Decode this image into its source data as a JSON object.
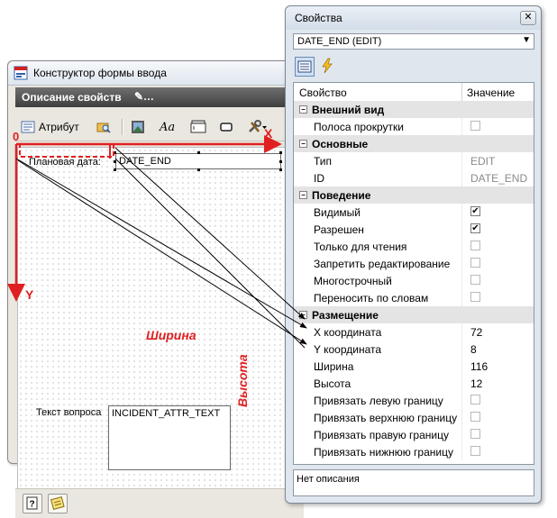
{
  "designer": {
    "title": "Конструктор формы ввода",
    "description_bar": "Описание свойств",
    "toolbar": {
      "attribute_label": "Атрибут"
    },
    "fields": [
      {
        "label": "Плановая дата:",
        "value": "DATE_END"
      },
      {
        "label": "Текст вопроса",
        "value": "INCIDENT_ATTR_TEXT"
      }
    ]
  },
  "annotations": {
    "origin": "0",
    "x_axis": "X",
    "y_axis": "Y",
    "width": "Ширина",
    "height": "Высота"
  },
  "properties": {
    "title": "Свойства",
    "close": "✕",
    "selected_object": "DATE_END (EDIT)",
    "columns": {
      "property": "Свойство",
      "value": "Значение"
    },
    "categories": [
      {
        "name": "Внешний вид",
        "rows": [
          {
            "name": "Полоса прокрутки",
            "type": "check",
            "checked": false
          }
        ]
      },
      {
        "name": "Основные",
        "rows": [
          {
            "name": "Тип",
            "type": "text",
            "value": "EDIT",
            "muted": true
          },
          {
            "name": "ID",
            "type": "text",
            "value": "DATE_END",
            "muted": true
          }
        ]
      },
      {
        "name": "Поведение",
        "rows": [
          {
            "name": "Видимый",
            "type": "check",
            "checked": true
          },
          {
            "name": "Разрешен",
            "type": "check",
            "checked": true
          },
          {
            "name": "Только для чтения",
            "type": "check",
            "checked": false
          },
          {
            "name": "Запретить редактирование",
            "type": "check",
            "checked": false
          },
          {
            "name": "Многострочный",
            "type": "check",
            "checked": false
          },
          {
            "name": "Переносить по словам",
            "type": "check",
            "checked": false
          }
        ]
      },
      {
        "name": "Размещение",
        "rows": [
          {
            "name": "X координата",
            "type": "text",
            "value": "72"
          },
          {
            "name": "Y координата",
            "type": "text",
            "value": "8"
          },
          {
            "name": "Ширина",
            "type": "text",
            "value": "116"
          },
          {
            "name": "Высота",
            "type": "text",
            "value": "12"
          },
          {
            "name": "Привязать левую границу",
            "type": "check",
            "checked": false
          },
          {
            "name": "Привязать верхнюю границу",
            "type": "check",
            "checked": false
          },
          {
            "name": "Привязать правую границу",
            "type": "check",
            "checked": false
          },
          {
            "name": "Привязать нижнюю границу",
            "type": "check",
            "checked": false
          }
        ]
      }
    ],
    "footer": "Нет описания"
  },
  "colors": {
    "annotation_red": "#e02020",
    "arrow_black": "#000000"
  }
}
